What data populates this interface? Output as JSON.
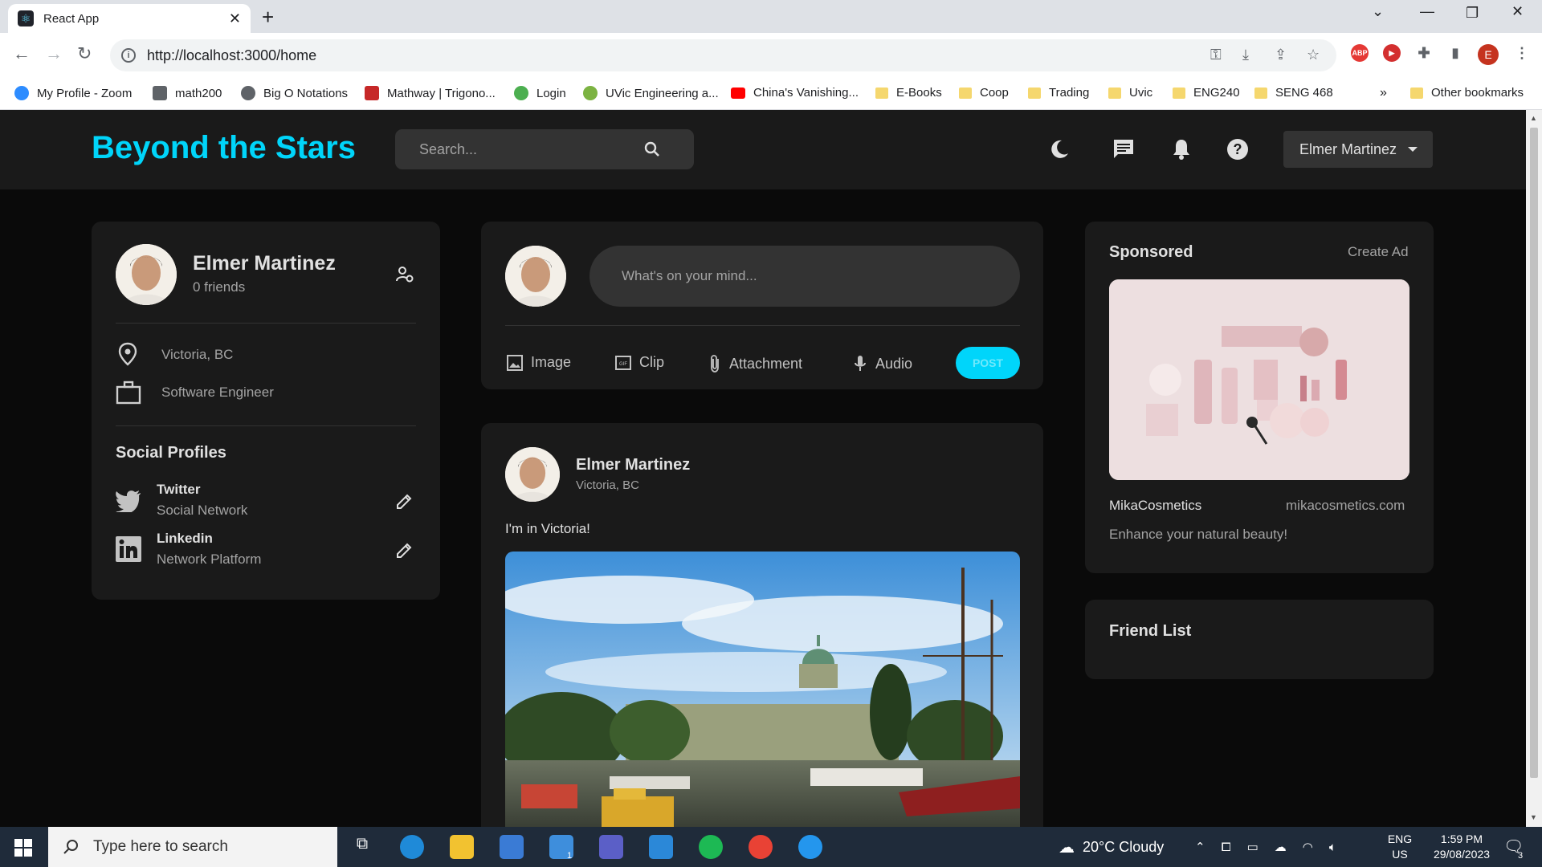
{
  "browser": {
    "tab_title": "React App",
    "url": "http://localhost:3000/home",
    "bookmarks": [
      {
        "label": "My Profile - Zoom",
        "color": "#2d8cff"
      },
      {
        "label": "math200",
        "color": "#5f6368"
      },
      {
        "label": "Big O Notations",
        "color": "#5f6368"
      },
      {
        "label": "Mathway | Trigono...",
        "color": "#c62828"
      },
      {
        "label": "Login",
        "color": "#4caf50"
      },
      {
        "label": "UVic Engineering a...",
        "color": "#7cb342"
      },
      {
        "label": "China's Vanishing...",
        "color": "#ff0000"
      },
      {
        "label": "E-Books",
        "color": "folder"
      },
      {
        "label": "Coop",
        "color": "folder"
      },
      {
        "label": "Trading",
        "color": "folder"
      },
      {
        "label": "Uvic",
        "color": "folder"
      },
      {
        "label": "ENG240",
        "color": "folder"
      },
      {
        "label": "SENG 468",
        "color": "folder"
      }
    ],
    "more_bookmarks": "»",
    "other_bookmarks": "Other bookmarks",
    "profile_initial": "E",
    "abp_label": "ABP"
  },
  "navbar": {
    "brand": "Beyond the Stars",
    "search_placeholder": "Search...",
    "user_name": "Elmer Martinez",
    "icons": [
      "dark-mode-icon",
      "message-icon",
      "notifications-icon",
      "help-icon"
    ]
  },
  "user_widget": {
    "name": "Elmer Martinez",
    "friends": "0 friends",
    "location": "Victoria, BC",
    "occupation": "Software Engineer",
    "social_title": "Social Profiles",
    "socials": [
      {
        "name": "Twitter",
        "type": "Social Network",
        "icon": "twitter-icon"
      },
      {
        "name": "Linkedin",
        "type": "Network Platform",
        "icon": "linkedin-icon"
      }
    ]
  },
  "post_composer": {
    "placeholder": "What's on your mind...",
    "actions": [
      "Image",
      "Clip",
      "Attachment",
      "Audio"
    ],
    "post_label": "POST"
  },
  "feed_post": {
    "author": "Elmer Martinez",
    "location": "Victoria, BC",
    "text": "I'm in Victoria!"
  },
  "sponsored": {
    "title": "Sponsored",
    "create_ad": "Create Ad",
    "brand": "MikaCosmetics",
    "site": "mikacosmetics.com",
    "tagline": "Enhance your natural beauty!"
  },
  "friend_list": {
    "title": "Friend List"
  },
  "taskbar": {
    "search_placeholder": "Type here to search",
    "weather": "20°C  Cloudy",
    "lang_top": "ENG",
    "lang_bottom": "US",
    "time": "1:59 PM",
    "date": "29/08/2023",
    "mail_badge": "1",
    "notif_count": "3"
  },
  "colors": {
    "accent": "#00d5fa",
    "background": "#0a0a0a",
    "card": "#1a1a1a"
  }
}
